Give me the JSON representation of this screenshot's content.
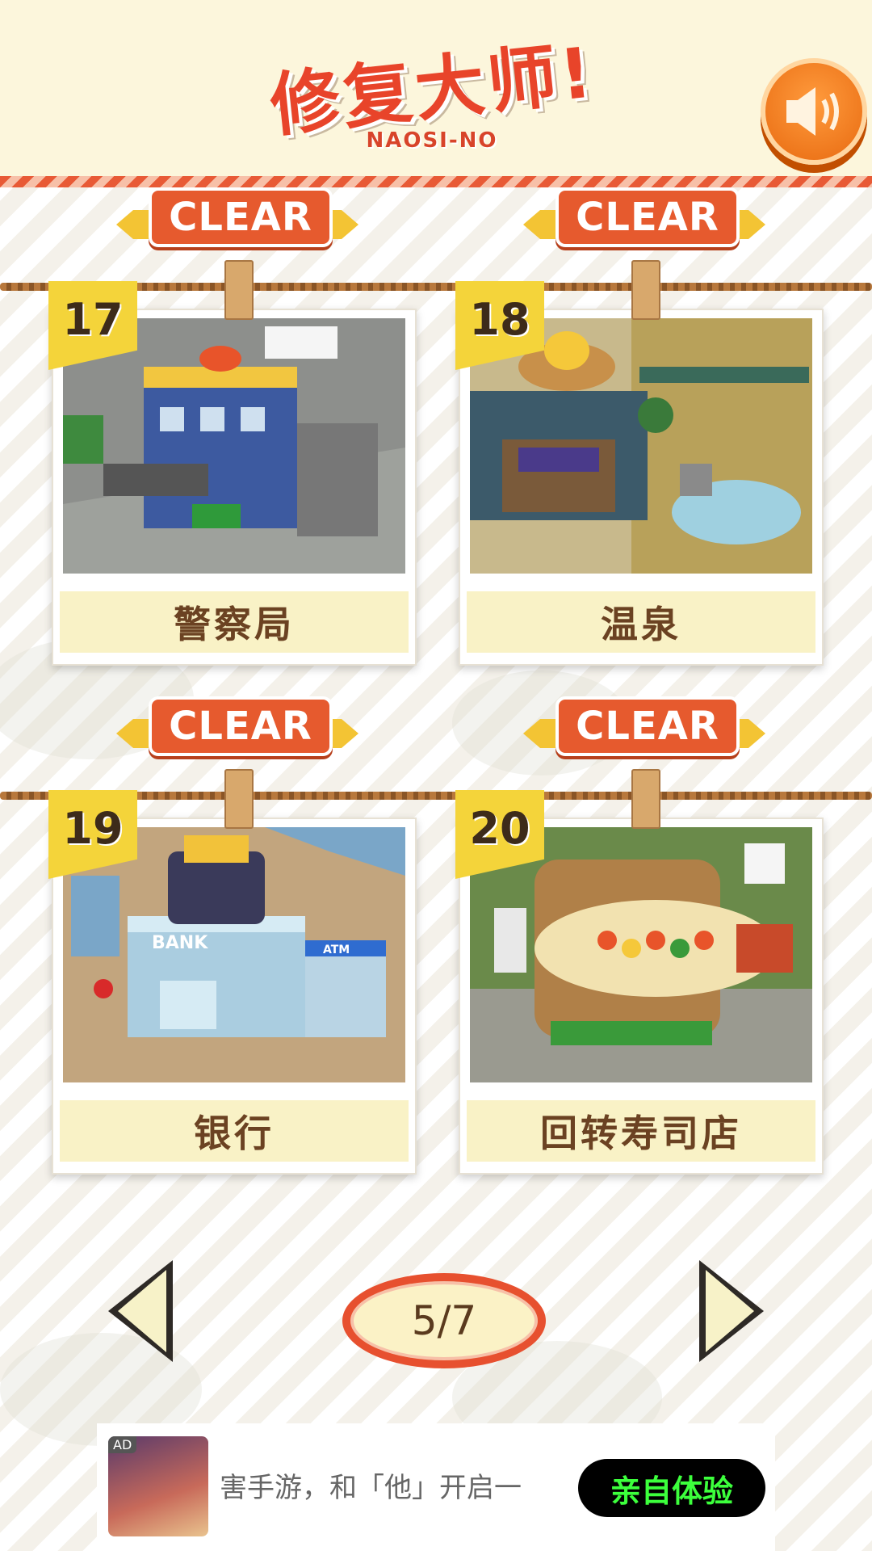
{
  "header": {
    "title": "修复大师!",
    "subtitle": "NAOSI-NO",
    "sound_icon": "speaker-icon"
  },
  "levels": [
    {
      "number": "17",
      "name": "警察局",
      "status": "CLEAR"
    },
    {
      "number": "18",
      "name": "温泉",
      "status": "CLEAR"
    },
    {
      "number": "19",
      "name": "银行",
      "status": "CLEAR"
    },
    {
      "number": "20",
      "name": "回转寿司店",
      "status": "CLEAR"
    }
  ],
  "pager": {
    "page_text": "5/7",
    "prev_icon": "left-triangle-icon",
    "next_icon": "right-triangle-icon"
  },
  "ad": {
    "tag": "AD",
    "text": "害手游，和「他」开启一",
    "button_label": "亲自体验"
  },
  "colors": {
    "accent": "#e65a2e",
    "tag_yellow": "#f4d43a",
    "label_bg": "#f9f2c6",
    "ad_button_text": "#3cff3c"
  }
}
